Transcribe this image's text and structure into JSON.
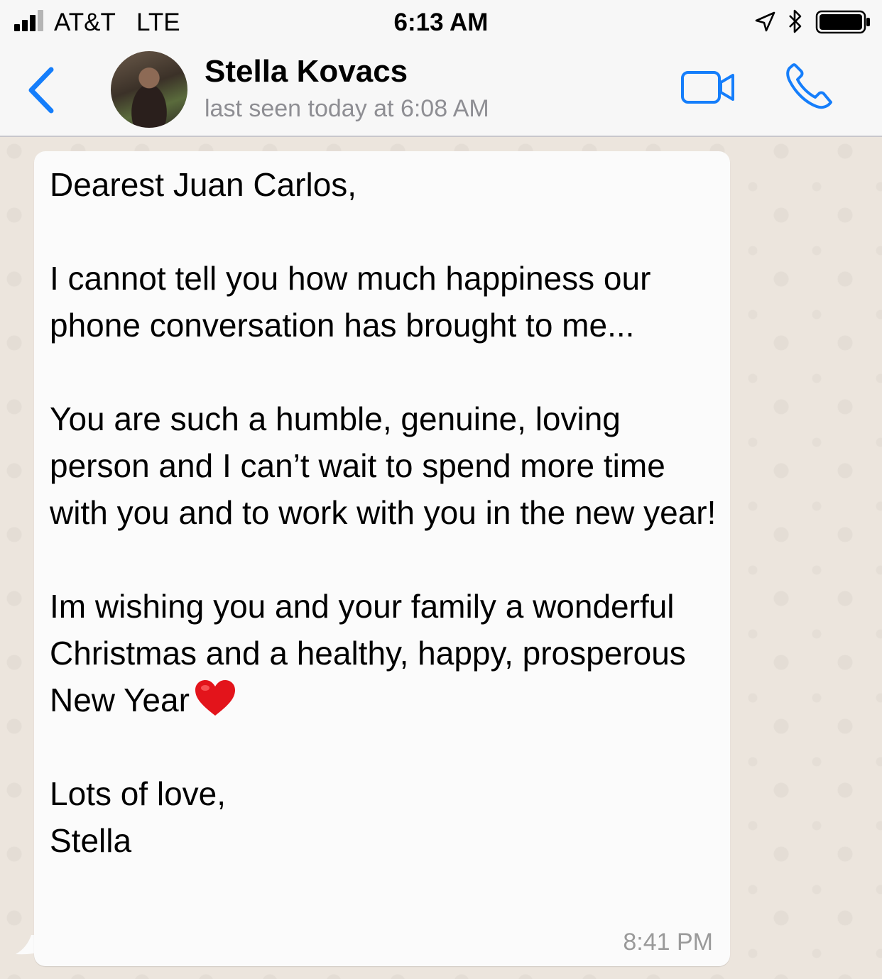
{
  "status_bar": {
    "carrier": "AT&T",
    "network": "LTE",
    "time": "6:13 AM",
    "icons": [
      "signal-bars-icon",
      "location-arrow-icon",
      "bluetooth-icon",
      "battery-icon"
    ]
  },
  "header": {
    "back_icon": "chevron-left-icon",
    "contact_name": "Stella Kovacs",
    "last_seen": "last seen today at 6:08 AM",
    "video_icon": "video-camera-icon",
    "call_icon": "phone-icon",
    "accent_color": "#157efb"
  },
  "messages": [
    {
      "direction": "incoming",
      "body": "Dearest Juan Carlos,\n\nI cannot tell you how much happiness our phone conversation has brought to me...\n\nYou are such a humble, genuine, loving person and I can’t wait to spend more time with you and to work with you in the new year!\n\nIm wishing you and your family a wonderful Christmas and a healthy, happy, prosperous New Year",
      "emoji": "red-heart-icon",
      "closing": "\n\nLots of love,\nStella",
      "time": "8:41 PM"
    }
  ]
}
